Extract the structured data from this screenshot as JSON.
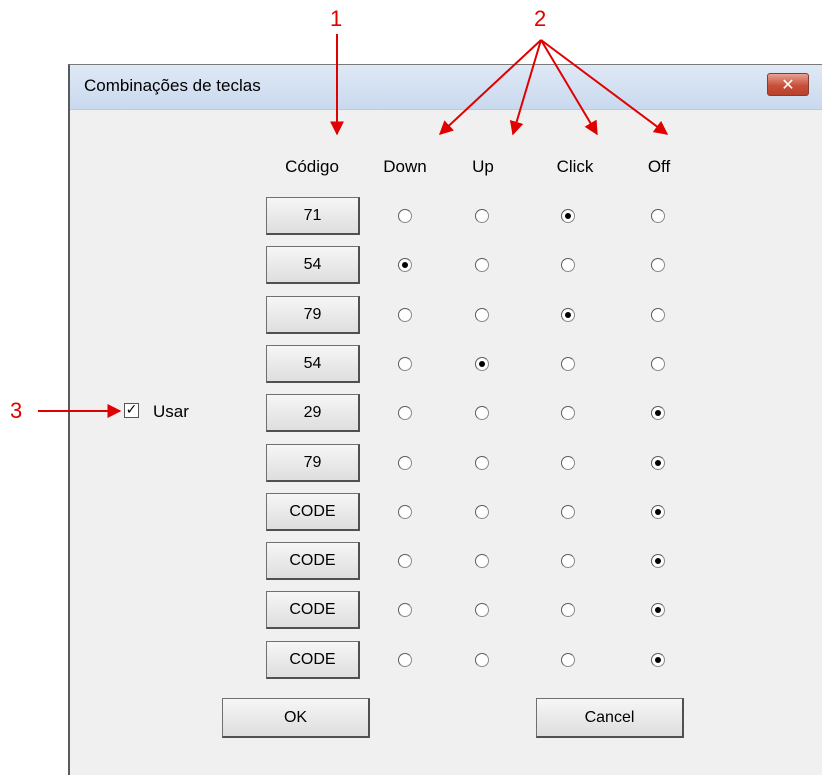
{
  "annotations": {
    "c1": "1",
    "c2": "2",
    "c3": "3"
  },
  "dialog": {
    "title": "Combinações de teclas",
    "close_glyph": "✕",
    "headers": {
      "code": "Código",
      "down": "Down",
      "up": "Up",
      "click": "Click",
      "off": "Off"
    },
    "rows": [
      {
        "code": "71",
        "selected": "click"
      },
      {
        "code": "54",
        "selected": "down"
      },
      {
        "code": "79",
        "selected": "click"
      },
      {
        "code": "54",
        "selected": "up"
      },
      {
        "code": "29",
        "selected": "off"
      },
      {
        "code": "79",
        "selected": "off"
      },
      {
        "code": "CODE",
        "selected": "off"
      },
      {
        "code": "CODE",
        "selected": "off"
      },
      {
        "code": "CODE",
        "selected": "off"
      },
      {
        "code": "CODE",
        "selected": "off"
      }
    ],
    "usar": {
      "label": "Usar",
      "checked": true,
      "check_glyph": "✓"
    },
    "ok_label": "OK",
    "cancel_label": "Cancel"
  },
  "colors": {
    "annotation": "#e00000"
  }
}
